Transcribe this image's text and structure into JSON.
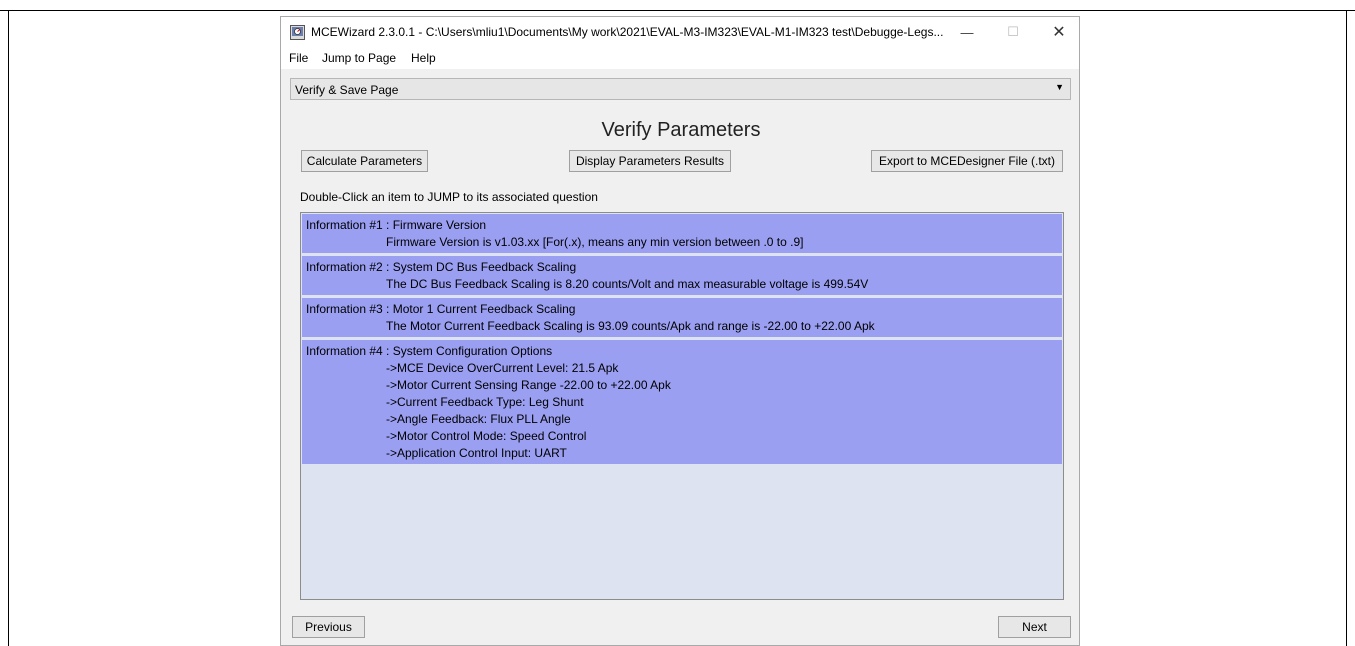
{
  "window": {
    "title": "MCEWizard 2.3.0.1  -  C:\\Users\\mliu1\\Documents\\My work\\2021\\EVAL-M3-IM323\\EVAL-M1-IM323 test\\Debugge-Legs...",
    "icon": "mcewizard-app-icon",
    "controls": {
      "minimize": "—",
      "maximize": "☐",
      "close": "✕"
    }
  },
  "menu": {
    "file": "File",
    "jump": "Jump to Page",
    "help": "Help"
  },
  "page_select": {
    "value": "Verify & Save Page",
    "caret": "▼"
  },
  "heading": "Verify Parameters",
  "buttons": {
    "calculate": "Calculate Parameters",
    "display": "Display Parameters Results",
    "export": "Export to MCEDesigner File (.txt)",
    "previous": "Previous",
    "next": "Next"
  },
  "hint": "Double-Click an item to JUMP to its associated question",
  "items": [
    {
      "title": "Information #1 : Firmware Version",
      "lines": [
        "Firmware Version is v1.03.xx [For(.x), means any min version between .0 to .9]"
      ]
    },
    {
      "title": "Information #2 : System DC Bus Feedback Scaling",
      "lines": [
        "The DC Bus Feedback Scaling is 8.20 counts/Volt and max measurable voltage is 499.54V"
      ]
    },
    {
      "title": "Information #3 : Motor 1 Current Feedback Scaling",
      "lines": [
        "The Motor Current Feedback Scaling is 93.09 counts/Apk and range is -22.00 to +22.00 Apk"
      ]
    },
    {
      "title": "Information #4 : System Configuration Options",
      "lines": [
        "->MCE Device OverCurrent Level:  21.5 Apk",
        "->Motor Current Sensing Range  -22.00 to +22.00 Apk",
        "->Current Feedback Type:  Leg Shunt",
        "->Angle Feedback: Flux PLL Angle",
        "->Motor Control Mode: Speed Control",
        "->Application Control Input: UART"
      ]
    }
  ]
}
